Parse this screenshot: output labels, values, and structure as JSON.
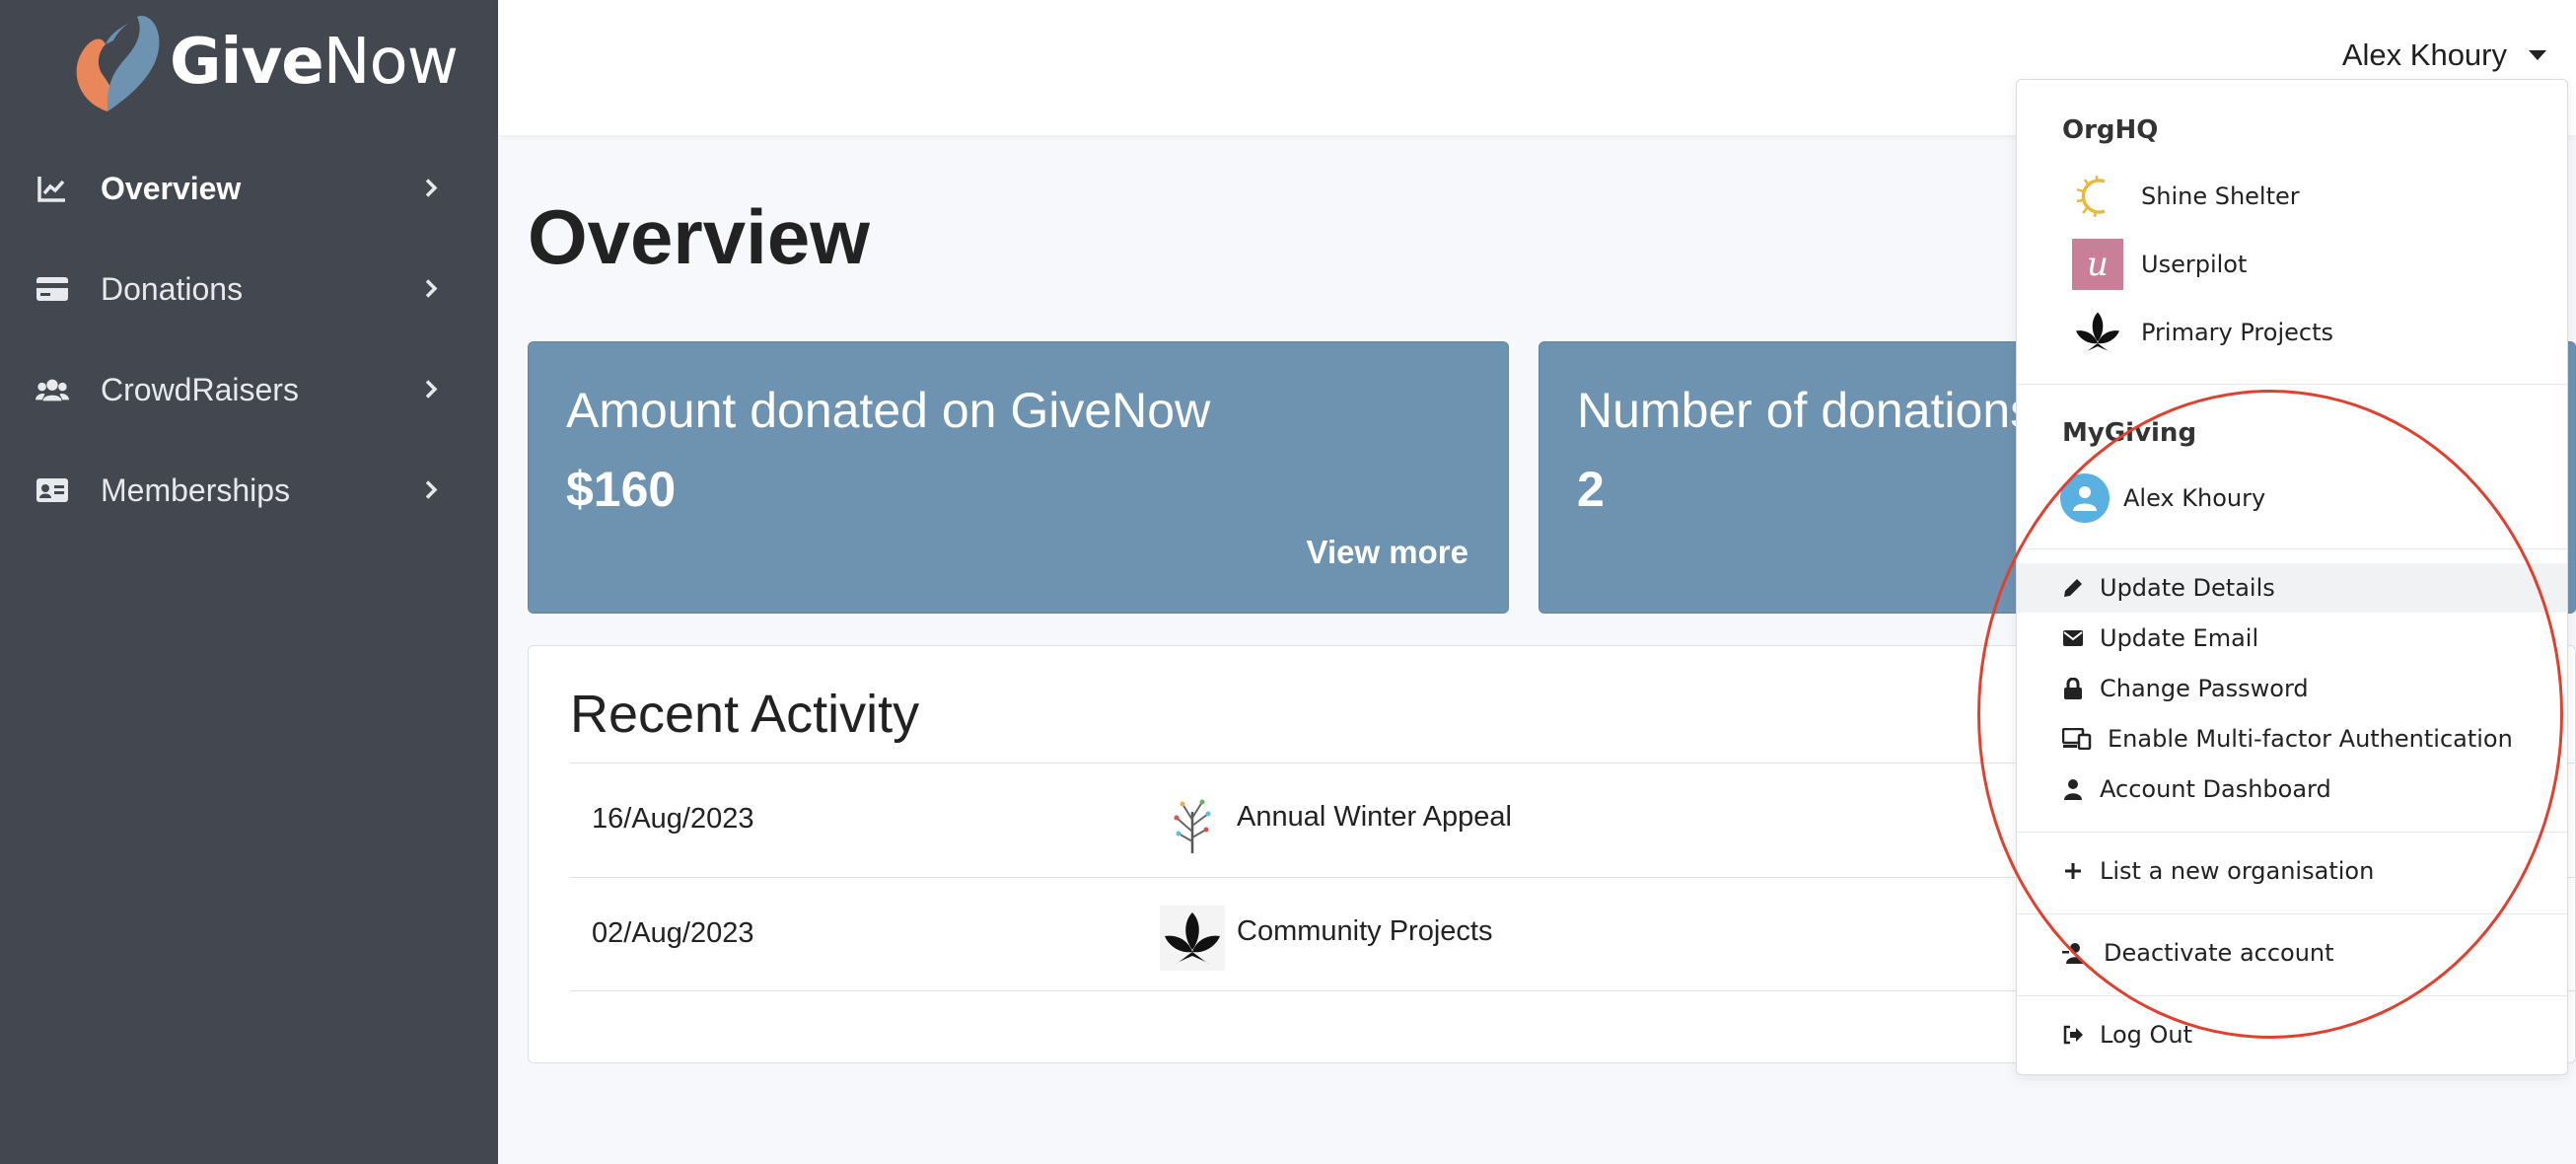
{
  "brand": {
    "name_bold": "Give",
    "name_light": "Now"
  },
  "sidebar": {
    "items": [
      {
        "label": "Overview",
        "icon": "chart-line-icon",
        "active": true
      },
      {
        "label": "Donations",
        "icon": "credit-card-icon",
        "active": false
      },
      {
        "label": "CrowdRaisers",
        "icon": "users-icon",
        "active": false
      },
      {
        "label": "Memberships",
        "icon": "id-card-icon",
        "active": false
      }
    ]
  },
  "header": {
    "user_name": "Alex Khoury"
  },
  "main": {
    "title": "Overview",
    "cards": [
      {
        "title": "Amount donated on GiveNow",
        "value": "$160",
        "link": "View more"
      },
      {
        "title": "Number of donations",
        "value": "2"
      }
    ],
    "activity": {
      "title": "Recent Activity",
      "rows": [
        {
          "date": "16/Aug/2023",
          "name": "Annual Winter Appeal"
        },
        {
          "date": "02/Aug/2023",
          "name": "Community Projects"
        }
      ]
    }
  },
  "dropdown": {
    "orghq": {
      "header": "OrgHQ",
      "orgs": [
        {
          "name": "Shine Shelter"
        },
        {
          "name": "Userpilot",
          "logo_letter": "u"
        },
        {
          "name": "Primary Projects"
        }
      ]
    },
    "mygiving": {
      "header": "MyGiving",
      "user": "Alex Khoury"
    },
    "account_items": [
      {
        "label": "Update Details",
        "icon": "pencil-icon"
      },
      {
        "label": "Update Email",
        "icon": "envelope-icon"
      },
      {
        "label": "Change Password",
        "icon": "lock-icon"
      },
      {
        "label": "Enable Multi-factor Authentication",
        "icon": "devices-icon"
      },
      {
        "label": "Account Dashboard",
        "icon": "user-icon"
      }
    ],
    "list_org": "List a new organisation",
    "deactivate": "Deactivate account",
    "logout": "Log Out"
  },
  "colors": {
    "sidebar_bg": "#434750",
    "card_bg": "#6e93b1",
    "annotation": "#e0412f",
    "logo_orange": "#e8875a",
    "logo_blue": "#6e93b1"
  }
}
